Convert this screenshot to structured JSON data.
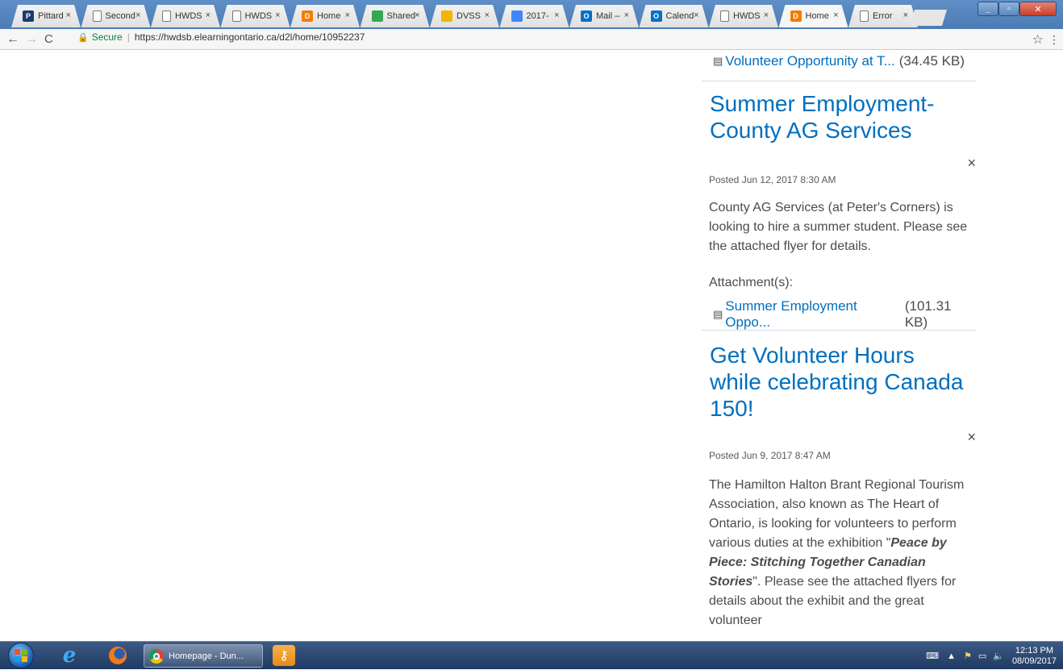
{
  "browser": {
    "tabs": [
      {
        "title": "Pittard",
        "favicon_color": "#1a3c6e",
        "favicon_glyph": "P"
      },
      {
        "title": "Second",
        "favicon_color": "#ffffff",
        "favicon_glyph": "doc"
      },
      {
        "title": "HWDS",
        "favicon_color": "#ffffff",
        "favicon_glyph": "doc"
      },
      {
        "title": "HWDS",
        "favicon_color": "#ffffff",
        "favicon_glyph": "doc"
      },
      {
        "title": "Home",
        "favicon_color": "#f57c00",
        "favicon_glyph": "D"
      },
      {
        "title": "Shared",
        "favicon_color": "#34a853",
        "favicon_glyph": "drive"
      },
      {
        "title": "DVSS",
        "favicon_color": "#f4b400",
        "favicon_glyph": "slides"
      },
      {
        "title": "2017-",
        "favicon_color": "#4285f4",
        "favicon_glyph": "docs"
      },
      {
        "title": "Mail –",
        "favicon_color": "#0072c6",
        "favicon_glyph": "O"
      },
      {
        "title": "Calend",
        "favicon_color": "#0072c6",
        "favicon_glyph": "O"
      },
      {
        "title": "HWDS",
        "favicon_color": "#ffffff",
        "favicon_glyph": "doc"
      },
      {
        "title": "Home",
        "favicon_color": "#f57c00",
        "favicon_glyph": "D"
      },
      {
        "title": "Error",
        "favicon_color": "#ffffff",
        "favicon_glyph": "doc"
      }
    ],
    "active_tab_index": 11,
    "security_label": "Secure",
    "url": "https://hwdsb.elearningontario.ca/d2l/home/10952237"
  },
  "news": {
    "top_attachment": {
      "name": "Volunteer Opportunity at T...",
      "size": "(34.45 KB)"
    },
    "items": [
      {
        "title": "Summer Employment- County AG Services",
        "posted": "Posted Jun 12, 2017 8:30 AM",
        "body": "County AG Services (at Peter's Corners) is looking to hire a summer student. Please see the attached flyer for details.",
        "attachments_label": "Attachment(s):",
        "attachment": {
          "name": "Summer Employment Oppo...",
          "size": "(101.31 KB)"
        }
      },
      {
        "title": "Get Volunteer Hours while celebrating Canada 150!",
        "posted": "Posted Jun 9, 2017 8:47 AM",
        "body_pre": "The Hamilton Halton Brant Regional Tourism Association, also known as The Heart of Ontario, is looking for volunteers to perform various duties at the exhibition \"",
        "body_em": "Peace by Piece:  Stitching Together Canadian Stories",
        "body_post": "\".  Please see the attached flyers for details about the exhibit and the great volunteer"
      }
    ],
    "dismiss_glyph": "×"
  },
  "taskbar": {
    "active_app_label": "Homepage - Dun...",
    "time": "12:13 PM",
    "date": "08/09/2017"
  },
  "colors": {
    "link": "#006fbf",
    "text": "#494c4e",
    "secure": "#0b8043"
  }
}
